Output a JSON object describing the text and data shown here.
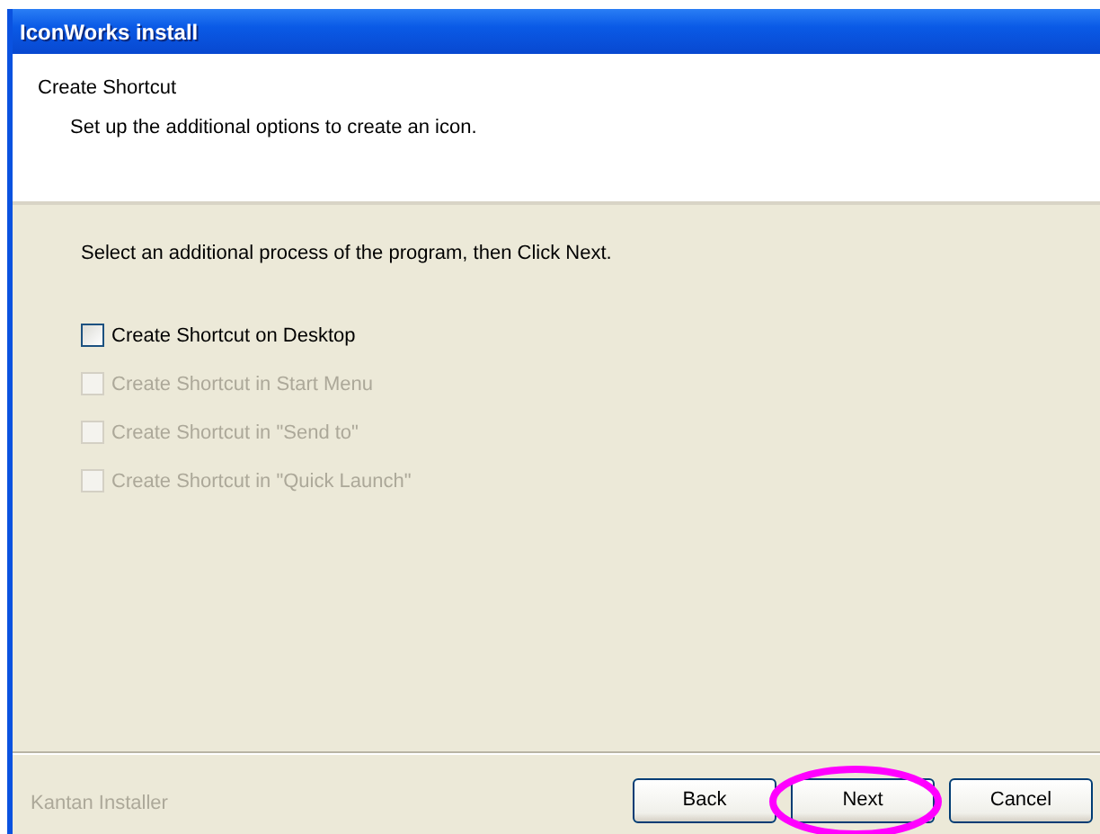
{
  "window": {
    "title": "IconWorks install"
  },
  "header": {
    "title": "Create Shortcut",
    "subtitle": "Set up the additional options to create an icon."
  },
  "instruction": "Select an additional process of the program, then Click Next.",
  "options": [
    {
      "label": "Create Shortcut on Desktop",
      "checked": false,
      "disabled": false
    },
    {
      "label": "Create Shortcut in Start Menu",
      "checked": false,
      "disabled": true
    },
    {
      "label": "Create Shortcut in \"Send to\"",
      "checked": false,
      "disabled": true
    },
    {
      "label": "Create Shortcut in \"Quick Launch\"",
      "checked": false,
      "disabled": true
    }
  ],
  "footer": {
    "brand": "Kantan Installer",
    "buttons": [
      {
        "label": "Back",
        "highlighted": false
      },
      {
        "label": "Next",
        "highlighted": true
      },
      {
        "label": "Cancel",
        "highlighted": false
      }
    ]
  }
}
